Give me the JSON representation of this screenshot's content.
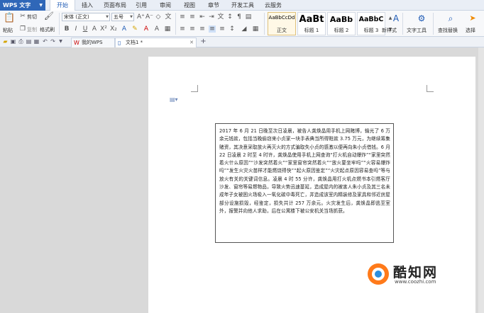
{
  "app": {
    "name": "WPS 文字"
  },
  "menu": {
    "items": [
      "开始",
      "插入",
      "页面布局",
      "引用",
      "审阅",
      "视图",
      "章节",
      "开发工具",
      "云服务"
    ],
    "active": "开始"
  },
  "ribbon": {
    "paste": "粘贴",
    "cut": "剪切",
    "copy": "复制",
    "format_painter": "格式刷",
    "font_name": "宋体 (正文)",
    "font_size": "五号",
    "styles": [
      {
        "sample": "AaBbCcDd",
        "name": "正文"
      },
      {
        "sample": "AaBt",
        "name": "标题 1"
      },
      {
        "sample": "AaBb",
        "name": "标题 2"
      },
      {
        "sample": "AaBbC",
        "name": "标题 3"
      }
    ],
    "new_style": "新样式",
    "text_tools": "文字工具",
    "find_replace": "查找替换",
    "select": "选择"
  },
  "tabs": [
    {
      "label": "我的WPS",
      "active": false
    },
    {
      "label": "文档1 *",
      "active": true
    }
  ],
  "document": {
    "body": "2017 年 6 月 21 日晚至次日凌晨，被告人龚焕晶用手机上网赌博，输光了 6 万余元钱款，包括当晚偷窃来小贞家一块手表典当所得赃款 3.75 万元，为继续筹集赌资，其决意采取放火再灭火的方式骗取失小贞的感激以便再向朱小贞借钱。6 月 22 日凌晨 2 时至 4 时许，龚焕晶使用手机上网查询“打火机自动爆炸”“家里突然着火什么原因”“沙发突然着火”“家里窗帘突然着火”“放火要坐牢吗”“火容易爆炸吗”“发生火灾火苗样才能燃烧得快”“起火原因鉴定”“火灾起点原因容易查吗”等与放火有关的关键词信息。凌晨 4 时 55 分许，龚焕晶用打火机点燃书本引燃客厅沙发、窗帘等易燃物品，导致火势迅速蔓延，造成屋内的被害人朱小贞及其三名未成年子女被困火场吸入一氧化碳中毒死亡，并造成该室内精装修及家具和邻近房屋部分设施损毁，经鉴定，损失共计 257 万余元。火灾发生后，龚焕晶即逃至室外，报警并向他人求助，后在公寓楼下被公安机关当场抓获。"
  },
  "watermark": {
    "name": "酷知网",
    "url": "www.coozhi.com"
  }
}
